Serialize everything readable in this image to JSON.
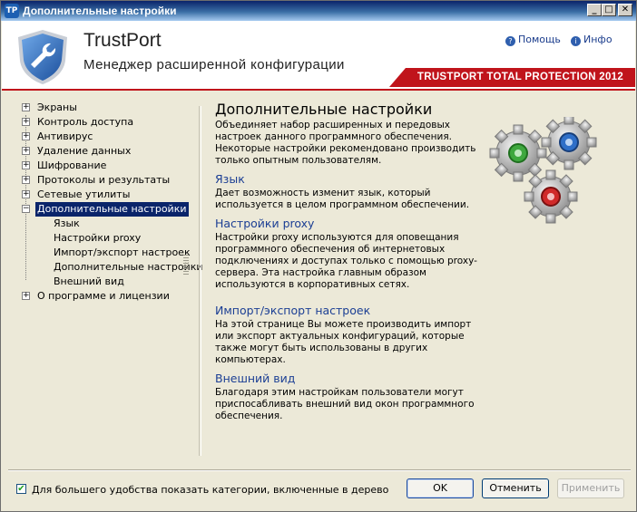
{
  "window": {
    "title": "Дополнительные настройки",
    "app_icon": "TP",
    "minimize_glyph": "_",
    "maximize_glyph": "□",
    "close_glyph": "✕"
  },
  "header": {
    "brand": "TrustPort",
    "subtitle": "Менеджер расширенной конфигурации",
    "help_label": "Помощь",
    "info_label": "Инфо",
    "product": "TRUSTPORT TOTAL PROTECTION 2012",
    "accent_color": "#c0141b"
  },
  "tree": {
    "items": [
      {
        "label": "Экраны",
        "expander": "+"
      },
      {
        "label": "Контроль доступа",
        "expander": "+"
      },
      {
        "label": "Антивирус",
        "expander": "+"
      },
      {
        "label": "Удаление данных",
        "expander": "+"
      },
      {
        "label": "Шифрование",
        "expander": "+"
      },
      {
        "label": "Протоколы и результаты",
        "expander": "+"
      },
      {
        "label": "Сетевые утилиты",
        "expander": "+"
      },
      {
        "label": "Дополнительные настройки",
        "expander": "−"
      },
      {
        "label": "Язык"
      },
      {
        "label": "Настройки proxy"
      },
      {
        "label": "Импорт/экспорт настроек"
      },
      {
        "label": "Дополнительные настройки"
      },
      {
        "label": "Внешний вид"
      },
      {
        "label": "О программе и лицензии",
        "expander": "+"
      }
    ]
  },
  "content": {
    "title": "Дополнительные настройки",
    "intro": "Объединяет набор расширенных и передовых настроек данного программного обеспечения. Некоторые настройки рекомендовано производить только опытным пользователям.",
    "sections": [
      {
        "heading": "Язык",
        "text": "Дает возможность изменит язык, который используется в целом программном обеспечении."
      },
      {
        "heading": "Настройки proxy",
        "text": "Настройки proxy используются для оповещания программного обеспечения об интернетовых подключениях и доступах только с помощью proxy-сервера. Эта настройка главным образом используются в корпоративных сетях."
      },
      {
        "heading": "Импорт/экспорт настроек",
        "text": "На этой странице Вы можете производить импорт или экспорт актуальных конфигураций, которые также могут быть использованы в других компьютерах."
      },
      {
        "heading": "Внешний вид",
        "text": "Благодаря этим настройкам пользователи могут приспосабливать внешний вид окон программного обеспечения."
      }
    ]
  },
  "footer": {
    "checkbox_label": "Для большего удобства показать категории, включенные в дерево",
    "checkbox_checked": true,
    "check_glyph": "✔",
    "ok_label": "OK",
    "cancel_label": "Отменить",
    "apply_label": "Применить"
  }
}
